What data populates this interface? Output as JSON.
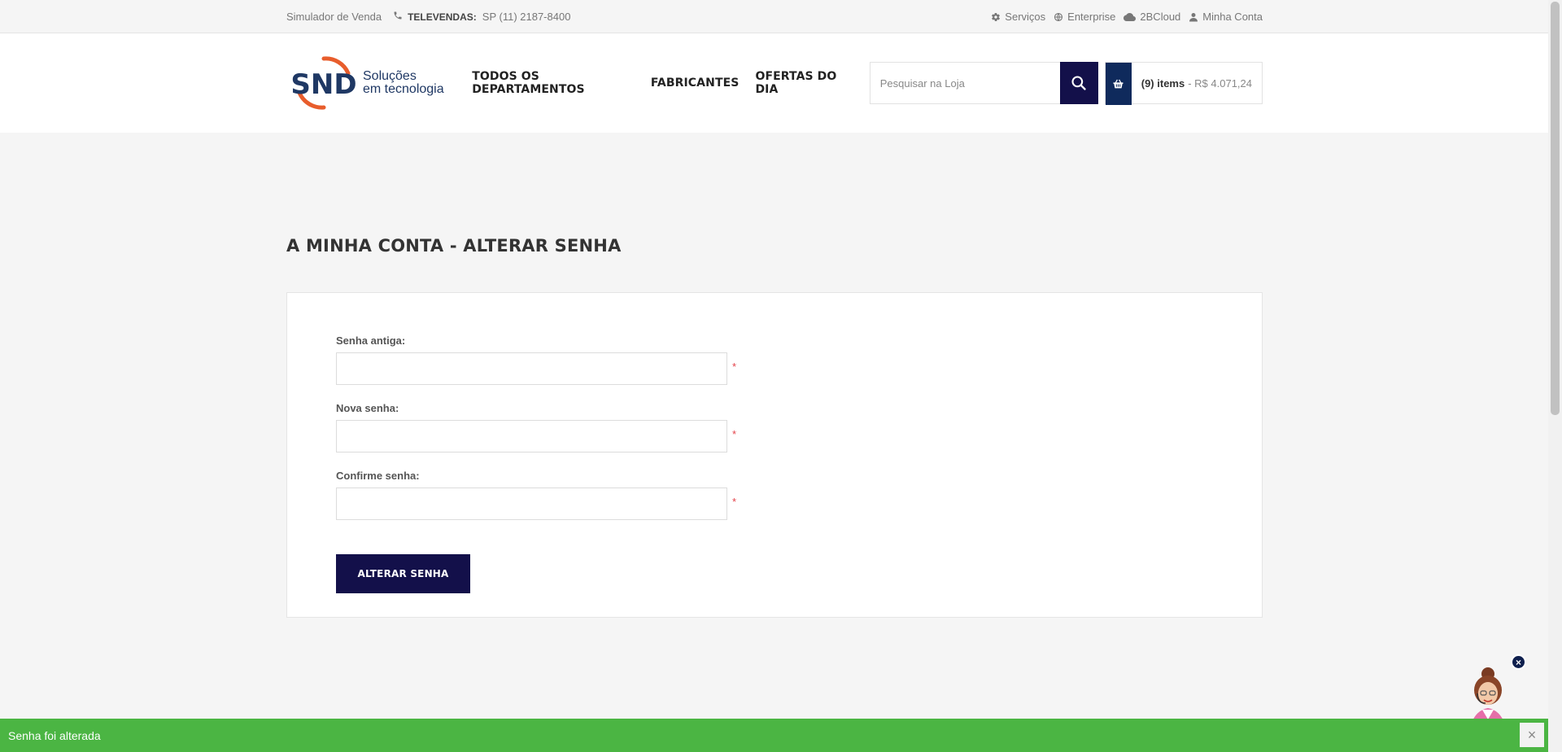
{
  "topbar": {
    "simulator": "Simulador de Venda",
    "televendas_label": "TELEVENDAS:",
    "televendas_phone": "SP (11)  2187-8400",
    "links": [
      {
        "label": "Serviços",
        "icon": "gear-icon"
      },
      {
        "label": "Enterprise",
        "icon": "globe-icon"
      },
      {
        "label": "2BCloud",
        "icon": "cloud-icon"
      },
      {
        "label": "Minha Conta",
        "icon": "user-icon"
      }
    ]
  },
  "logo": {
    "text": "SND",
    "tagline_1": "Soluções",
    "tagline_2": "em tecnologia"
  },
  "nav": {
    "departments": "TODOS OS DEPARTAMENTOS",
    "manufacturers": "FABRICANTES",
    "offers": "OFERTAS DO DIA"
  },
  "search": {
    "placeholder": "Pesquisar na Loja"
  },
  "cart": {
    "count": "(9) items",
    "total": "- R$ 4.071,24"
  },
  "page": {
    "title": "A MINHA CONTA - ALTERAR SENHA"
  },
  "form": {
    "old_password_label": "Senha antiga:",
    "new_password_label": "Nova senha:",
    "confirm_password_label": "Confirme senha:",
    "required_mark": "*",
    "submit_label": "ALTERAR SENHA"
  },
  "notification": {
    "message": "Senha foi alterada",
    "close": "×"
  },
  "assistant": {
    "close": "×"
  },
  "colors": {
    "brand_navy": "#13104a",
    "brand_orange": "#e85d2c",
    "success_green": "#4bb543",
    "required_red": "#e4434b"
  }
}
